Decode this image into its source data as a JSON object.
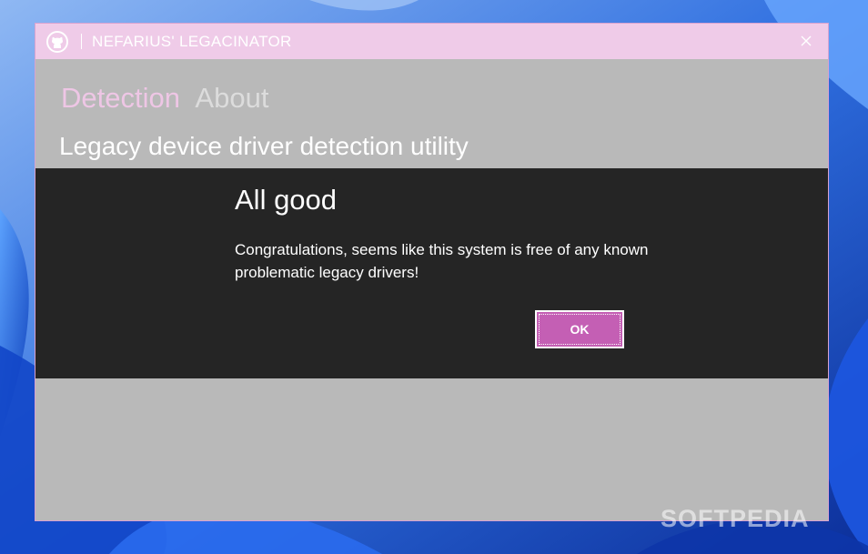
{
  "window": {
    "title": "NEFARIUS' LEGACINATOR",
    "icon": "github-icon",
    "close_icon": "close-icon"
  },
  "tabs": [
    {
      "label": "Detection",
      "active": true
    },
    {
      "label": "About",
      "active": false
    }
  ],
  "subtitle": "Legacy device driver detection utility",
  "dialog": {
    "title": "All good",
    "message": "Congratulations, seems like this system is free of any known problematic legacy drivers!",
    "ok_label": "OK"
  },
  "watermark": "SOFTPEDIA",
  "colors": {
    "titlebar": "#efcbe8",
    "window_bg": "#b9b9b9",
    "dialog_bg": "#252525",
    "accent": "#c45fb4",
    "active_tab": "#eec6e5"
  }
}
